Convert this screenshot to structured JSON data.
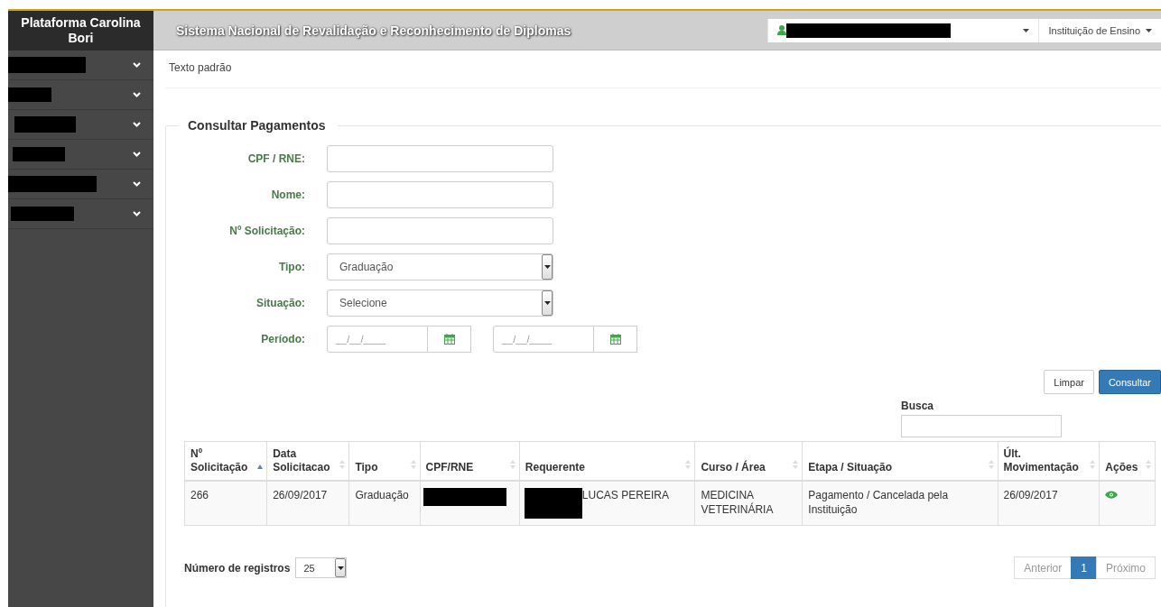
{
  "sidebar": {
    "title": "Plataforma Carolina Bori",
    "items": [
      {
        "expanded": false
      },
      {
        "expanded": false
      },
      {
        "expanded": false
      },
      {
        "expanded": false
      },
      {
        "expanded": false
      },
      {
        "expanded": false
      }
    ]
  },
  "header": {
    "title": "Sistema Nacional de Revalidação e Reconhecimento de Diplomas",
    "institution_menu": "Instituição de Ensino"
  },
  "breadcrumb": "Texto padrão",
  "form": {
    "legend": "Consultar Pagamentos",
    "fields": [
      {
        "kind": "text",
        "label": "CPF / RNE:"
      },
      {
        "kind": "text",
        "label": "Nome:"
      },
      {
        "kind": "text",
        "label": "Nº Solicitação:"
      },
      {
        "kind": "select",
        "label": "Tipo:",
        "value": "Graduação"
      },
      {
        "kind": "select",
        "label": "Situação:",
        "value": "Selecione"
      },
      {
        "kind": "daterange",
        "label": "Período:",
        "from": "__/__/____",
        "to": "__/__/____"
      }
    ],
    "buttons": [
      {
        "label": "Limpar",
        "primary": false
      },
      {
        "label": "Consultar",
        "primary": true
      }
    ]
  },
  "search": {
    "label": "Busca"
  },
  "table": {
    "columns": [
      {
        "label": "Nº Solicitação",
        "sorted": true
      },
      {
        "label": "Data Solicitacao",
        "sorted": false
      },
      {
        "label": "Tipo",
        "sorted": false
      },
      {
        "label": "CPF/RNE",
        "sorted": false
      },
      {
        "label": "Requerente",
        "sorted": false
      },
      {
        "label": "Curso / Área",
        "sorted": false
      },
      {
        "label": "Etapa / Situação",
        "sorted": false
      },
      {
        "label": "Últ. Movimentação",
        "sorted": false
      },
      {
        "label": "Ações",
        "sorted": false
      }
    ],
    "rows": [
      {
        "numero": "266",
        "data": "26/09/2017",
        "tipo": "Graduação",
        "requerente": "LUCAS PEREIRA",
        "curso": "MEDICINA VETERINÁRIA",
        "etapa": "Pagamento / Cancelada pela Instituição",
        "movimentacao": "26/09/2017"
      }
    ]
  },
  "page_size": {
    "label": "Número de registros",
    "value": "25"
  },
  "pagination": [
    {
      "label": "Anterior",
      "selected": false,
      "disabled": true
    },
    {
      "label": "1",
      "selected": true,
      "disabled": false
    },
    {
      "label": "Próximo",
      "selected": false,
      "disabled": true
    }
  ]
}
